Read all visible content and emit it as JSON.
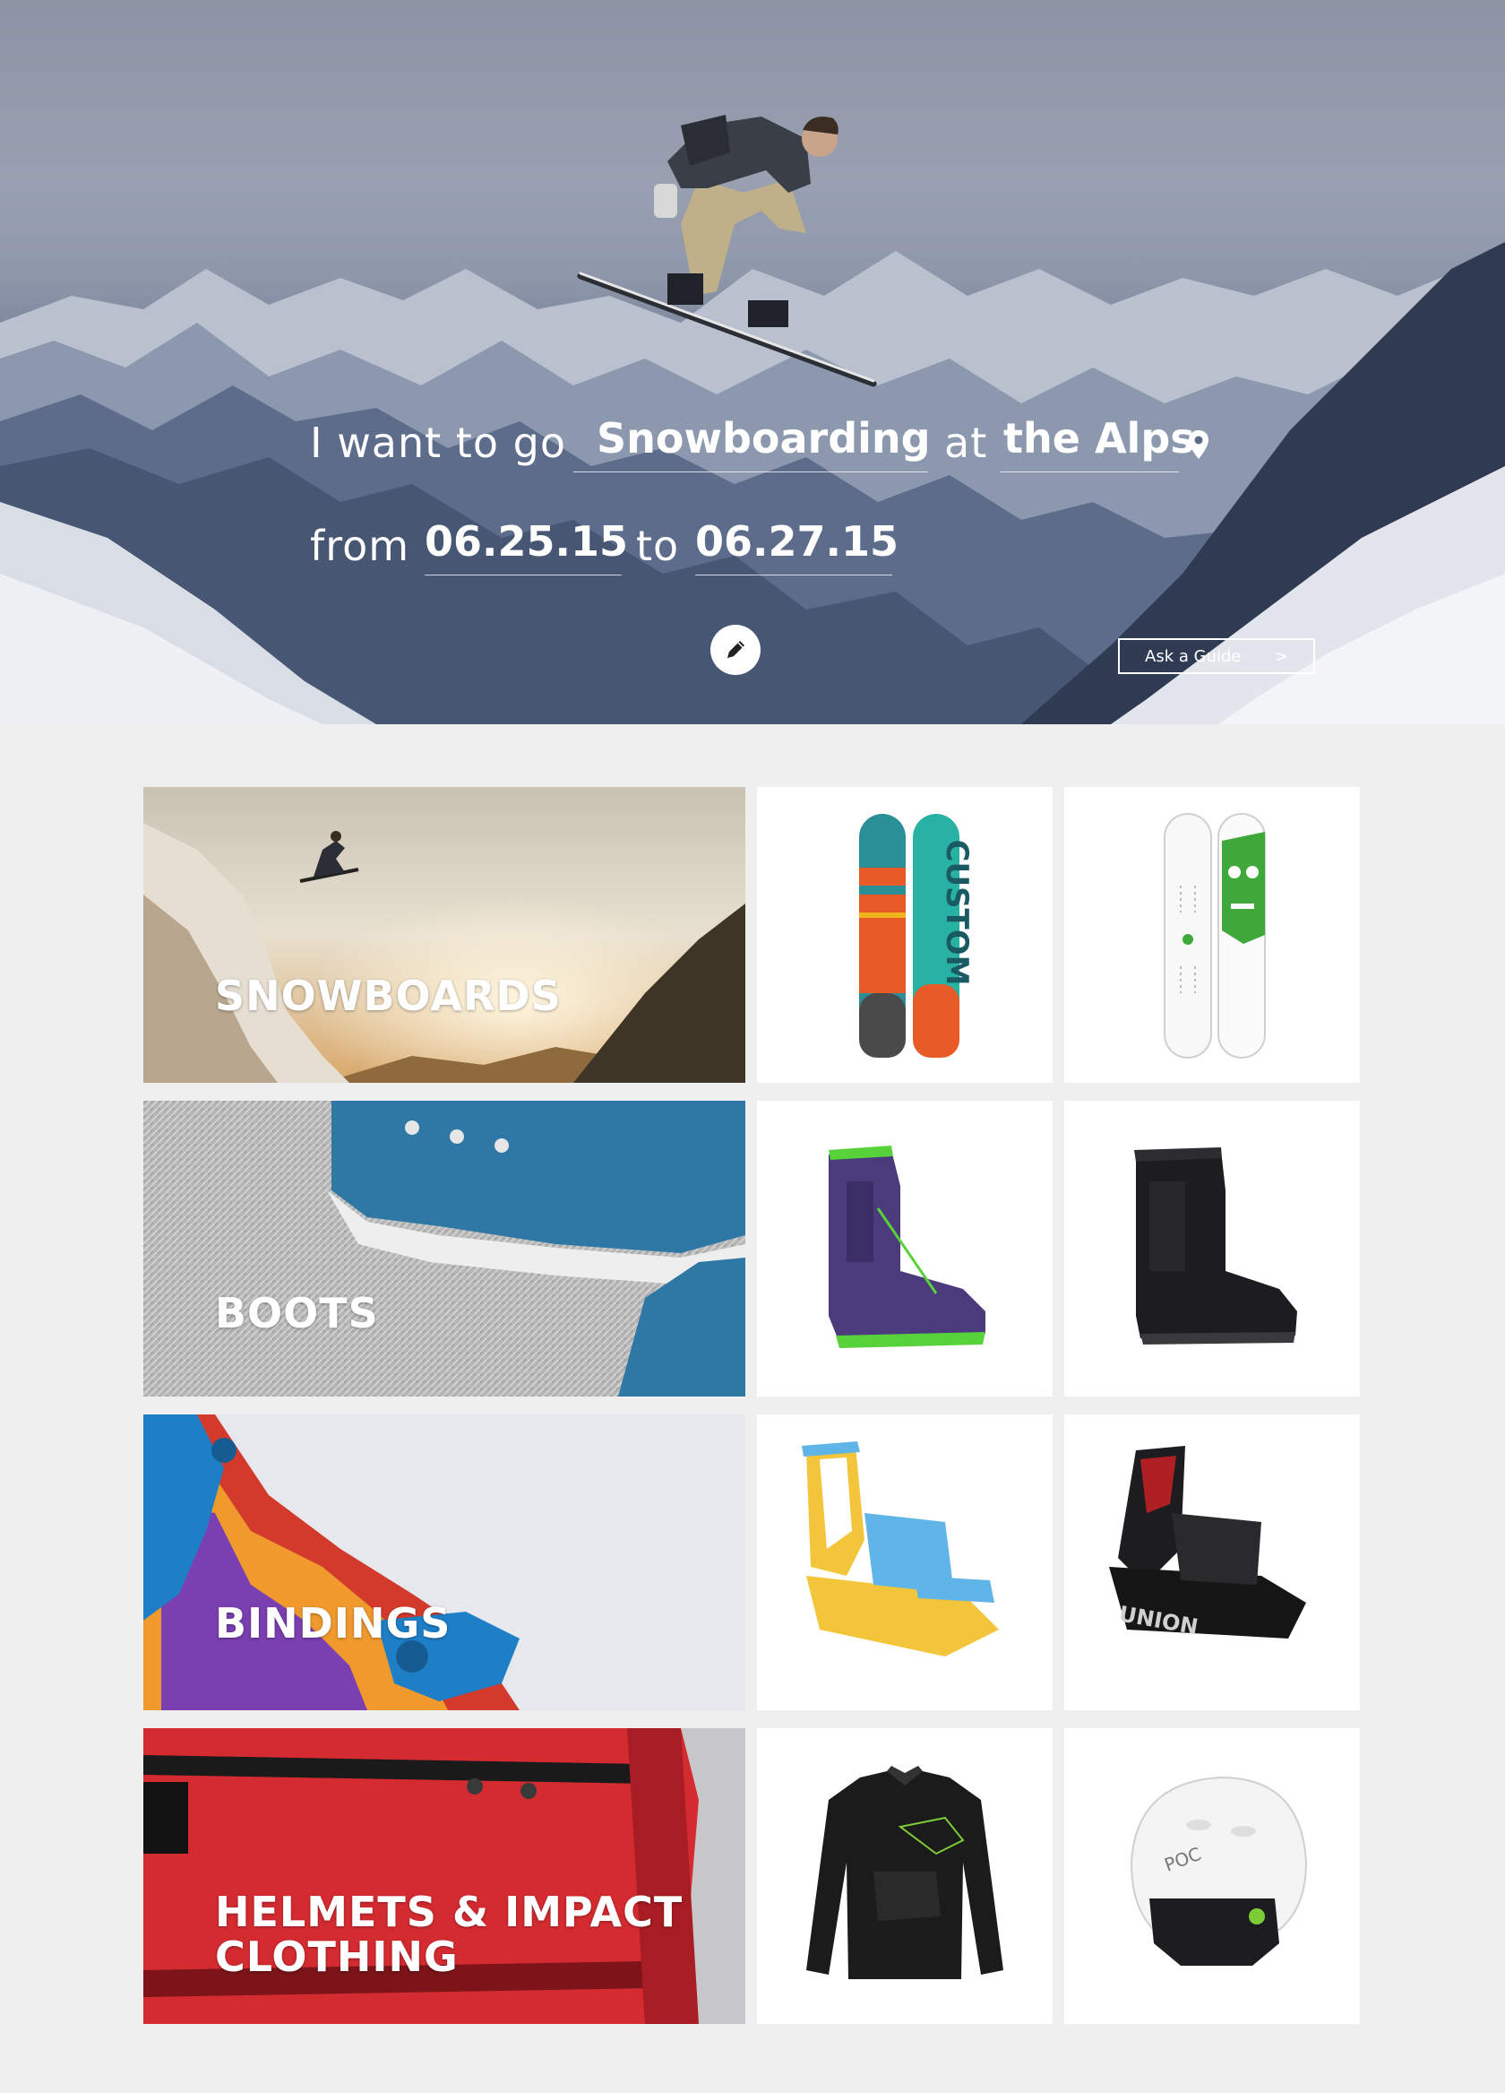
{
  "hero": {
    "line1_prefix": "I want to go",
    "activity": "Snowboarding",
    "line1_mid": "at",
    "location": "the Alps",
    "line2_prefix": "from",
    "date_from": "06.25.15",
    "line2_mid": "to",
    "date_to": "06.27.15",
    "guide_button": "Ask a Guide",
    "guide_arrow": ">"
  },
  "categories": [
    {
      "label": "SNOWBOARDS",
      "products": [
        "custom-snowboard",
        "skull-snowboard"
      ]
    },
    {
      "label": "BOOTS",
      "products": [
        "purple-boot",
        "black-boot"
      ]
    },
    {
      "label": "BINDINGS",
      "products": [
        "yellow-binding",
        "union-binding"
      ]
    },
    {
      "label_line1": "HELMETS & IMPACT",
      "label_line2": "CLOTHING",
      "products": [
        "impact-shirt",
        "poc-helmet"
      ]
    }
  ],
  "colors": {
    "page_bg": "#efefef",
    "tile_bg": "#ffffff",
    "hero_text": "#ffffff"
  }
}
